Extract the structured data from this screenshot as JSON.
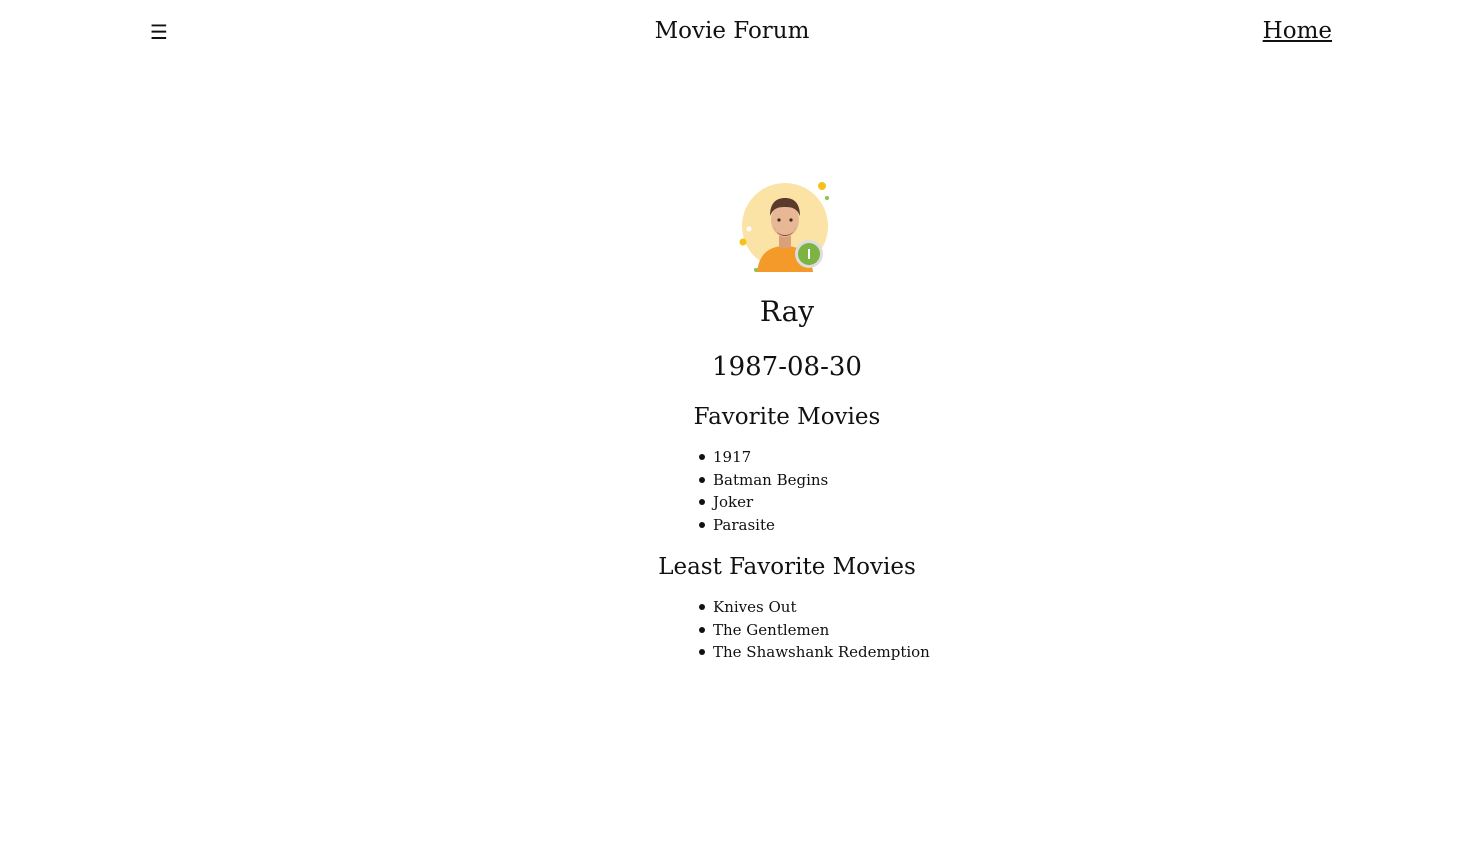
{
  "header": {
    "menu_icon": "☰",
    "site_title": "Movie Forum",
    "home_label": "Home"
  },
  "profile": {
    "avatar_icon": "user-avatar-icon",
    "name": "Ray",
    "birth_date": "1987-08-30",
    "favorite_title": "Favorite Movies",
    "favorite_movies": [
      "1917",
      "Batman Begins",
      "Joker",
      "Parasite"
    ],
    "least_favorite_title": "Least Favorite Movies",
    "least_favorite_movies": [
      "Knives Out",
      "The Gentlemen",
      "The Shawshank Redemption"
    ]
  },
  "colors": {
    "background": "#ffffff",
    "text": "#111111",
    "avatar_background": "#fbe3a5",
    "avatar_shirt": "#f39a2b",
    "avatar_badge": "#7cb342"
  }
}
